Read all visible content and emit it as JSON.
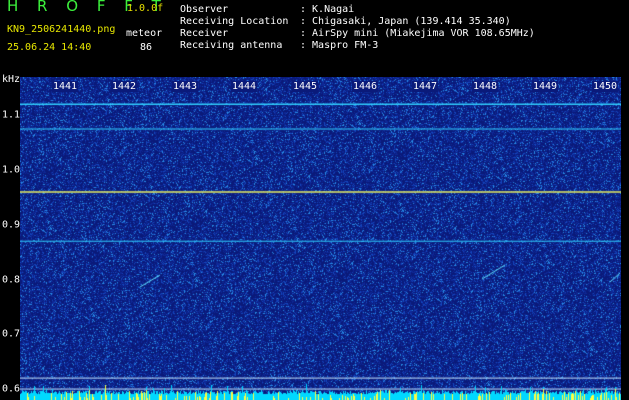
{
  "header": {
    "app_title": "H R O F F T",
    "version": "1.0.0f",
    "filename": "KN9_2506241440.png",
    "timestamp": "25.06.24 14:40",
    "mode_label": "meteor",
    "mode_value": "86"
  },
  "info": [
    {
      "label": "Observer",
      "value": ": K.Nagai"
    },
    {
      "label": "Receiving Location",
      "value": ": Chigasaki, Japan (139.414 35.340)"
    },
    {
      "label": "Receiver",
      "value": ": AirSpy mini (Miakejima VOR 108.65MHz)"
    },
    {
      "label": "Receiving antenna",
      "value": ": Maspro FM-3"
    }
  ],
  "y_unit": "kHz",
  "x_ticks": [
    "1441",
    "1442",
    "1443",
    "1444",
    "1445",
    "1446",
    "1447",
    "1448",
    "1449",
    "1450"
  ],
  "y_ticks": [
    "1.1",
    "1.0",
    "0.9",
    "0.8",
    "0.7",
    "0.6"
  ],
  "y_ticks_small": [
    "1.1",
    "1.0",
    "0.9",
    "0.8",
    "0.7",
    "0.6"
  ],
  "colors": {
    "background": "#000000",
    "plot_bg": "#0a1a7a",
    "trace": "#30d0ff",
    "carrier": "#e8f060",
    "baseline": "#00d8ff",
    "title_green": "#3cf03c",
    "header_yellow": "#e8e800"
  },
  "chart_data": {
    "type": "heatmap",
    "x_label_values": [
      1441,
      1442,
      1443,
      1444,
      1445,
      1446,
      1447,
      1448,
      1449,
      1450
    ],
    "y_label_values": [
      1.1,
      1.0,
      0.9,
      0.8,
      0.7,
      0.6
    ],
    "y_unit": "kHz",
    "horizontal_lines_khz": [
      1.12,
      1.075,
      0.96,
      0.87,
      0.62,
      0.6
    ],
    "ylim": [
      0.58,
      1.17
    ]
  }
}
